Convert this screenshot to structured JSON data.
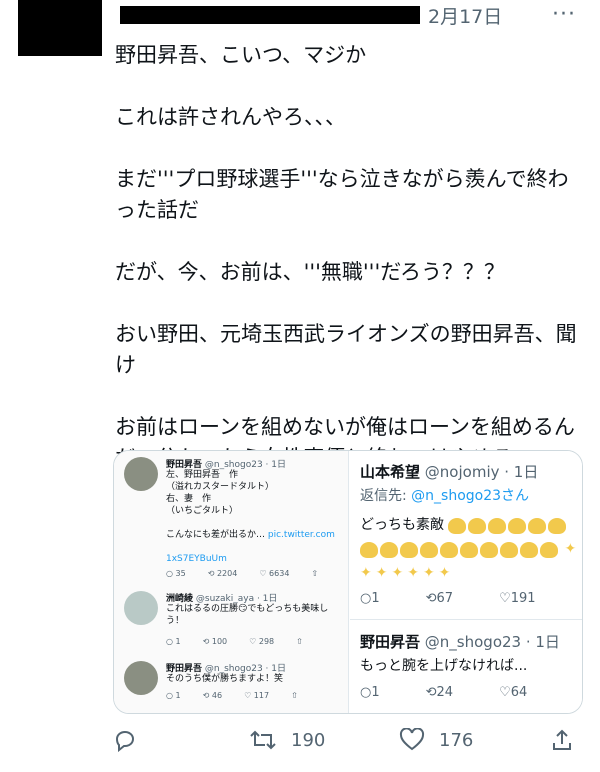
{
  "header": {
    "date": "2月17日",
    "more_icon": "more-icon"
  },
  "tweet": {
    "paragraphs": [
      "野田昇吾、こいつ、マジか",
      "これは許されんやろ、、、",
      "まだ'''プロ野球選手'''なら泣きながら羨んで終わった話だ",
      "だが、今、お前は、'''無職'''だろう？？？",
      "おい野田、元埼玉西武ライオンズの野田昇吾、聞け",
      "お前はローンを組めないが俺はローンを組めるんだ、分かったら女性声優と絡むのはやめろ"
    ]
  },
  "media": {
    "left": {
      "t1": {
        "name": "野田昇吾",
        "meta": "@n_shogo23 · 1日",
        "text": "左、野田昇吾　作\n（溢れカスタードタルト）\n右、妻　作\n（いちごタルト）\n\nこんなにも差が出るか…",
        "link": "pic.twitter.com/1xS7EYBuUm",
        "link_display_1": "pic.twitter.com",
        "link_display_2": "1xS7EYBuUm",
        "replies": "35",
        "retweets": "2204",
        "likes": "6634"
      },
      "t2": {
        "name": "洲崎綾",
        "meta": "@suzaki_aya · 1日",
        "text": "これはるるの圧勝😏でもどっちも美味し\nう！",
        "replies": "1",
        "retweets": "100",
        "likes": "298"
      },
      "t3": {
        "name": "野田昇吾",
        "meta": "@n_shogo23 · 1日",
        "text": "そのうち僕が勝ちますよ！笑",
        "replies": "1",
        "retweets": "46",
        "likes": "117"
      }
    },
    "right": {
      "r1": {
        "name": "山本希望",
        "meta": "@nojomiy · 1日",
        "reply_to_label": "返信先: ",
        "reply_to_user": "@n_shogo23さん",
        "text": "どっちも素敵",
        "replies": "1",
        "retweets": "67",
        "likes": "191"
      },
      "r2": {
        "name": "野田昇吾",
        "meta": "@n_shogo23 · 1日",
        "text": "もっと腕を上げなければ...",
        "replies": "1",
        "retweets": "24",
        "likes": "64"
      }
    }
  },
  "actions": {
    "reply_icon": "reply-icon",
    "retweet_icon": "retweet-icon",
    "like_icon": "like-icon",
    "share_icon": "share-icon",
    "retweets": "190",
    "likes": "176"
  }
}
